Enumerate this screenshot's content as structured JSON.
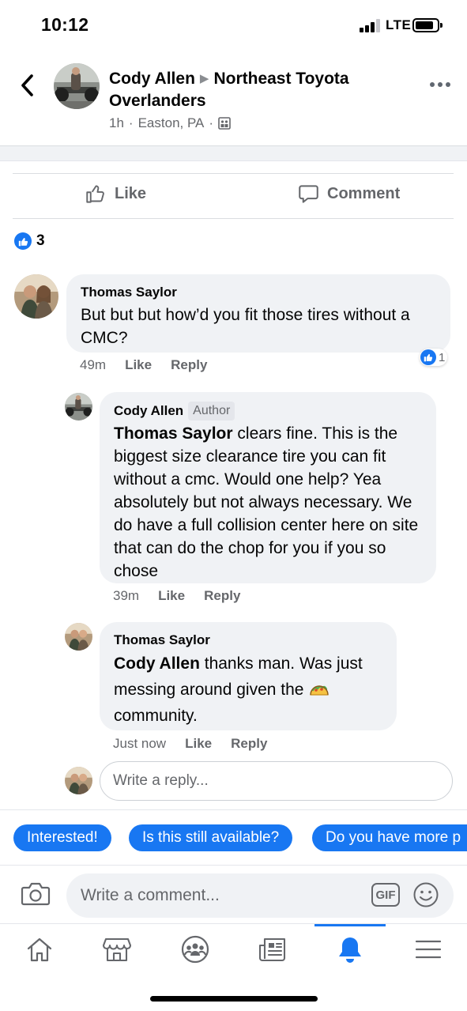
{
  "status_bar": {
    "time": "10:12",
    "network": "LTE"
  },
  "post": {
    "author": "Cody Allen",
    "group": "Northeast Toyota Overlanders",
    "time": "1h",
    "location": "Easton, PA",
    "separator": "·"
  },
  "actions": {
    "like_label": "Like",
    "comment_label": "Comment"
  },
  "reactions": {
    "count": "3"
  },
  "comments": [
    {
      "name": "Thomas Saylor",
      "text": "But but but how’d you fit those tires without a CMC?",
      "time": "49m",
      "like": "Like",
      "reply": "Reply",
      "reaction_count": "1"
    },
    {
      "name": "Cody Allen",
      "badge": "Author",
      "mention": "Thomas Saylor",
      "text": " clears fine. This is the biggest size clearance tire you can fit without a cmc. Would one help? Yea absolutely but not always necessary. We do have a full collision center here on site that can do the chop for you if you so chose",
      "time": "39m",
      "like": "Like",
      "reply": "Reply"
    },
    {
      "name": "Thomas Saylor",
      "mention": "Cody Allen",
      "text": " thanks man. Was just messing around given the",
      "text_end": "community.",
      "time": "Just now",
      "like": "Like",
      "reply": "Reply"
    }
  ],
  "reply_input": {
    "placeholder": "Write a reply..."
  },
  "quick_replies": [
    "Interested!",
    "Is this still available?",
    "Do you have more p"
  ],
  "comment_input": {
    "placeholder": "Write a comment...",
    "gif_label": "GIF"
  },
  "tabs": [
    "home-icon",
    "marketplace-icon",
    "groups-icon",
    "news-icon",
    "notifications-icon",
    "menu-icon"
  ],
  "colors": {
    "accent": "#1877f2",
    "bubble": "#f0f2f5",
    "secondary_text": "#65676b"
  }
}
